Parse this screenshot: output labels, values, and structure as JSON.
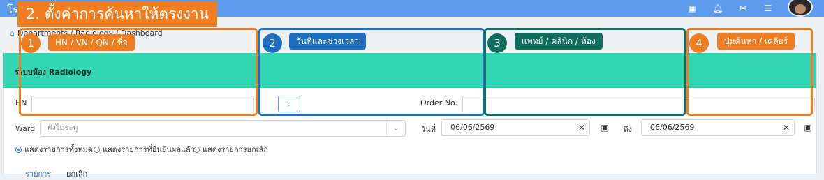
{
  "app_title": "โรง",
  "tutorial_title": "2. ตั้งค่าการค้นหาให้ตรงงาน",
  "breadcrumb": "Departments / Radiology / Dashboard",
  "panel_title": "ระบบห้อง Radiology",
  "form": {
    "hn_label": "HN",
    "hn_value": "",
    "order_label": "Order No.",
    "order_value": "",
    "ward_label": "Ward",
    "ward_placeholder": "ยังไม่ระบุ",
    "date_label": "วันที่",
    "date_from": "06/06/2569",
    "to_label": "ถึง",
    "date_to": "06/06/2569"
  },
  "filters": [
    {
      "label": "แสดงรายการทั้งหมด",
      "selected": true
    },
    {
      "label": "แสดงรายการที่ยืนยันผลแล้ว",
      "selected": false
    },
    {
      "label": "แสดงรายการยกเลิก",
      "selected": false
    }
  ],
  "tabs": [
    {
      "label": "รายการ",
      "active": true
    },
    {
      "label": "ยกเลิก",
      "active": false
    }
  ],
  "annotations": [
    {
      "number": "1",
      "label": "HN / VN / QN / ชื่อ",
      "color": "#ef7d22"
    },
    {
      "number": "2",
      "label": "วันที่และช่วงเวลา",
      "color": "#1f6fc1"
    },
    {
      "number": "3",
      "label": "แพทย์ / คลินิก / ห้อง",
      "color": "#116e5e"
    },
    {
      "number": "4",
      "label": "ปุ่มค้นหา / เคลียร์",
      "color": "#ef7d22"
    }
  ],
  "colors": {
    "topbar": "#5d9cec",
    "panel_header": "#33d6b3",
    "orange": "#ef7d22",
    "blue": "#1f6fc1",
    "teal": "#116e5e"
  },
  "icons": [
    "grid-icon",
    "bell-icon",
    "mail-icon",
    "checklist-icon",
    "home-icon",
    "search-icon",
    "chevron-down-icon",
    "clear-icon",
    "calendar-icon"
  ]
}
